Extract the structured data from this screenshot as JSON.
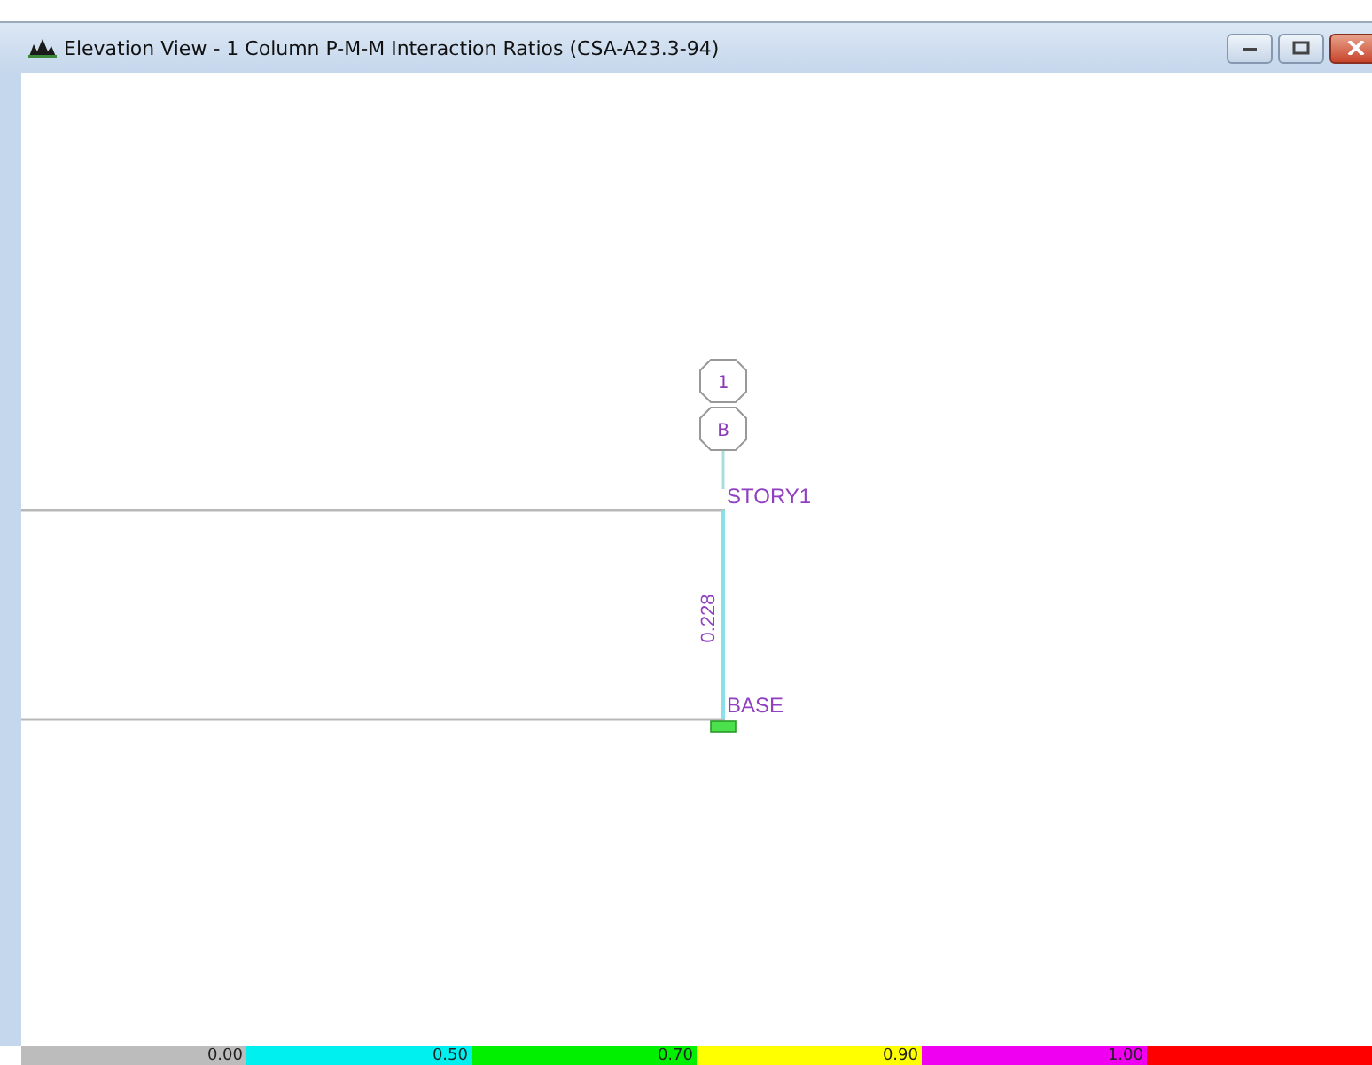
{
  "window": {
    "title": "Elevation View - 1  Column P-M-M Interaction Ratios  (CSA-A23.3-94)"
  },
  "grid_bubbles": [
    {
      "label": "1"
    },
    {
      "label": "B"
    }
  ],
  "stories": [
    {
      "label": "STORY1"
    },
    {
      "label": "BASE"
    }
  ],
  "column": {
    "ratio": "0.228"
  },
  "legend": [
    {
      "label": "0.00",
      "color": "#bcbcbc"
    },
    {
      "label": "0.50",
      "color": "#00f0f0"
    },
    {
      "label": "0.70",
      "color": "#00f000"
    },
    {
      "label": "0.90",
      "color": "#ffff00"
    },
    {
      "label": "1.00",
      "color": "#f000f0"
    },
    {
      "color": "#ff0000"
    }
  ]
}
